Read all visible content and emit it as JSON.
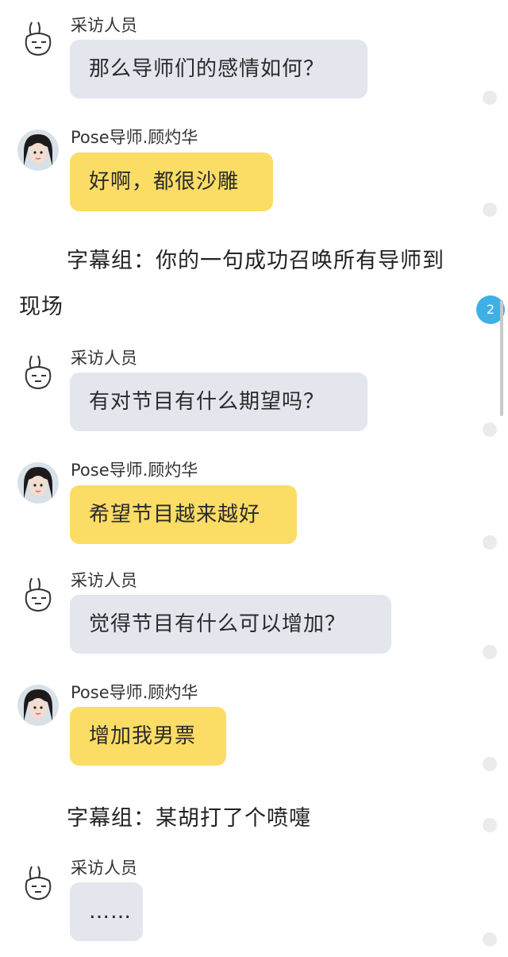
{
  "messages": [
    {
      "sender": "采访人员",
      "text": "那么导师们的感情如何？",
      "style": "gray",
      "avatar": "rabbit-icon"
    },
    {
      "sender": "Pose导师.顾灼华",
      "text": "好啊，都很沙雕",
      "style": "yellow",
      "avatar": "girl-avatar"
    },
    {
      "sender": "采访人员",
      "text": "有对节目有什么期望吗？",
      "style": "gray",
      "avatar": "rabbit-icon"
    },
    {
      "sender": "Pose导师.顾灼华",
      "text": "希望节目越来越好",
      "style": "yellow",
      "avatar": "girl-avatar"
    },
    {
      "sender": "采访人员",
      "text": "觉得节目有什么可以增加？",
      "style": "gray",
      "avatar": "rabbit-icon"
    },
    {
      "sender": "Pose导师.顾灼华",
      "text": "增加我男票",
      "style": "yellow",
      "avatar": "girl-avatar"
    },
    {
      "sender": "采访人员",
      "text": "……",
      "style": "gray",
      "avatar": "rabbit-icon"
    }
  ],
  "narrations": [
    {
      "line1": "字幕组：你的一句成功召唤所有导师到",
      "line2": "现场"
    },
    {
      "line1": "字幕组：某胡打了个喷嚏",
      "line2": ""
    }
  ],
  "unread_badge": "2",
  "colors": {
    "bubble_gray": "#e4e6ee",
    "bubble_yellow": "#fbdc65",
    "badge": "#3fb0e6"
  }
}
